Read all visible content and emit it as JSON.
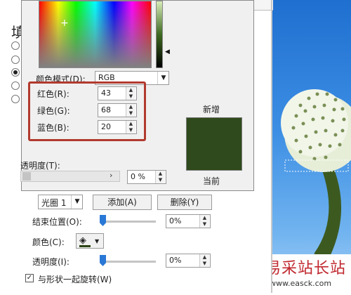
{
  "pane": {
    "title_char": "填",
    "gradient_stop": {
      "value": "光圈 1"
    },
    "add_button": "添加(A)",
    "delete_button": "删除(Y)",
    "end_position_label": "结束位置(O):",
    "end_position_value": "0%",
    "color_label": "颜色(C):",
    "transparency_label": "透明度(I):",
    "transparency_value": "0%",
    "rotate_with_shape_label": "与形状一起旋转(W)",
    "rotate_with_shape_checked": true
  },
  "dialog": {
    "color_mode_label": "颜色模式(D):",
    "color_mode_value": "RGB",
    "red_label": "红色(R):",
    "green_label": "绿色(G):",
    "blue_label": "蓝色(B):",
    "red": "43",
    "green": "68",
    "blue": "20",
    "transparency_label": "透明度(T):",
    "transparency_value": "0 %",
    "new_label": "新增",
    "current_label": "当前",
    "color_hex": "#2b4414"
  },
  "watermark": {
    "title": "易采站长站",
    "url": "www.easck.com"
  }
}
